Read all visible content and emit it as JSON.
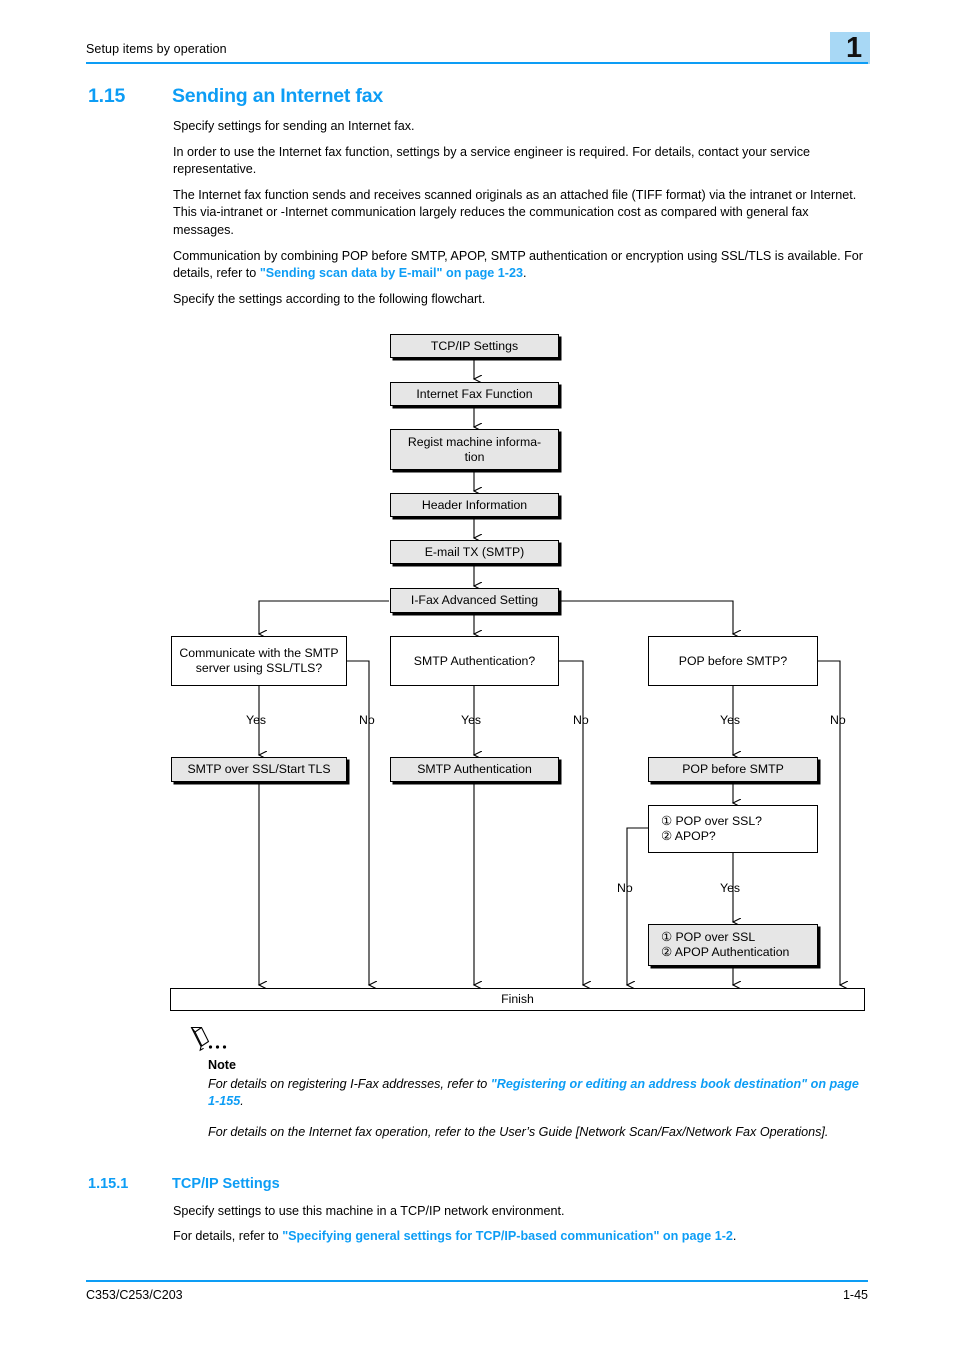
{
  "header": {
    "running_head": "Setup items by operation",
    "chapter_number": "1",
    "accent_color": "#0d9df5",
    "tab_color": "#a8d8f5"
  },
  "section": {
    "number": "1.15",
    "title": "Sending an Internet fax"
  },
  "paragraphs": {
    "p1": "Specify settings for sending an Internet fax.",
    "p2": "In order to use the Internet fax function, settings by a service engineer is required. For details, contact your service representative.",
    "p3": "The Internet fax function sends and receives scanned originals as an attached file (TIFF format) via the intranet or Internet. This via-intranet or -Internet communication largely reduces the communication cost as compared with general fax messages.",
    "p4_pre": "Communication by combining POP before SMTP, APOP, SMTP authentication or encryption using SSL/TLS is available. For details, refer to ",
    "p4_link": "\"Sending scan data by E-mail\" on page 1-23",
    "p4_post": ".",
    "p5": "Specify the settings according to the following flowchart."
  },
  "flowchart": {
    "boxes": {
      "tcpip": "TCP/IP Settings",
      "ifax_function": "Internet Fax Function",
      "regist_machine": "Regist machine informa-\ntion",
      "header_info": "Header Information",
      "email_tx": "E-mail TX (SMTP)",
      "ifax_advanced": "I-Fax Advanced Setting",
      "q_ssl": "Communicate with the SMTP\nserver using SSL/TLS?",
      "q_smtp_auth": "SMTP Authentication?",
      "q_pop_before_smtp": "POP before SMTP?",
      "smtp_over_ssl": "SMTP over SSL/Start TLS",
      "smtp_auth": "SMTP Authentication",
      "pop_before_smtp": "POP before SMTP",
      "q_pop_ssl_apop": "① POP over SSL?\n② APOP?",
      "pop_ssl_apop": "① POP over SSL\n② APOP Authentication",
      "finish": "Finish"
    },
    "labels": {
      "yes1": "Yes",
      "no1": "No",
      "yes2": "Yes",
      "no2": "No",
      "yes3": "Yes",
      "no3": "No",
      "no4": "No",
      "yes4": "Yes"
    }
  },
  "note": {
    "title": "Note",
    "p1_pre": "For details on registering I-Fax addresses, refer to ",
    "p1_link": "\"Registering or editing an address book destination\" on page 1-155",
    "p1_post": ".",
    "p2": "For details on the Internet fax operation, refer to the User’s Guide [Network Scan/Fax/Network Fax Operations]."
  },
  "subsection": {
    "number": "1.15.1",
    "title": "TCP/IP Settings",
    "p1": "Specify settings to use this machine in a TCP/IP network environment.",
    "p2_pre": "For details, refer to ",
    "p2_link": "\"Specifying general settings for TCP/IP-based communication\" on page 1-2",
    "p2_post": "."
  },
  "footer": {
    "model": "C353/C253/C203",
    "page": "1-45"
  }
}
